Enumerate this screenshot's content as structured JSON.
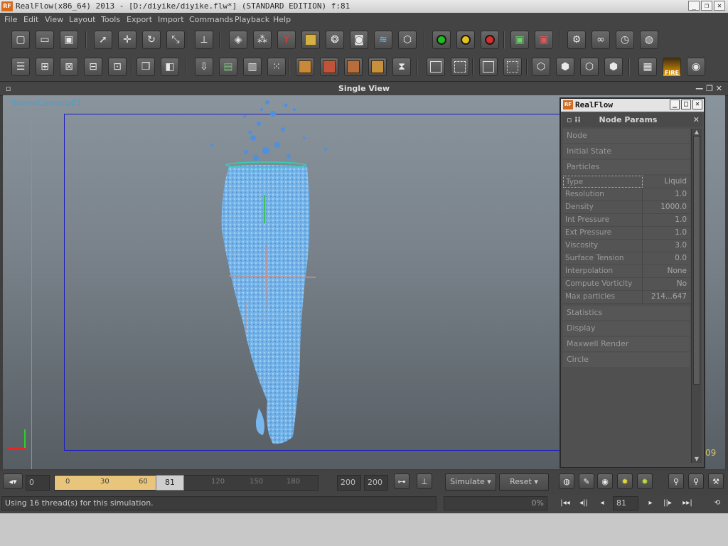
{
  "window": {
    "title": "RealFlow(x86_64) 2013 - [D:/diyike/diyike.flw*] (STANDARD EDITION) f:81",
    "logo_text": "RF",
    "minimize": "_",
    "maximize": "❐",
    "close": "✕"
  },
  "menu": [
    "File",
    "Edit",
    "View",
    "Layout",
    "Tools",
    "Export",
    "Import",
    "Commands",
    "Playback",
    "Help"
  ],
  "viewport": {
    "header": "Single View",
    "camera_label": "SceneCamera01",
    "frame_corner": "09"
  },
  "panel": {
    "title": "RealFlow",
    "logo_text": "RF",
    "header": "Node Params",
    "close": "✕",
    "sections_top": [
      "Node",
      "Initial State",
      "Particles"
    ],
    "params": [
      {
        "k": "Type",
        "v": "Liquid"
      },
      {
        "k": "Resolution",
        "v": "1.0"
      },
      {
        "k": "Density",
        "v": "1000.0"
      },
      {
        "k": "Int Pressure",
        "v": "1.0"
      },
      {
        "k": "Ext Pressure",
        "v": "1.0"
      },
      {
        "k": "Viscosity",
        "v": "3.0"
      },
      {
        "k": "Surface Tension",
        "v": "0.0"
      },
      {
        "k": "Interpolation",
        "v": "None"
      },
      {
        "k": "Compute Vorticity",
        "v": "No"
      },
      {
        "k": "Max particles",
        "v": "214...647"
      }
    ],
    "sections_bottom": [
      "Statistics",
      "Display",
      "Maxwell Render",
      "Circle"
    ]
  },
  "timeline": {
    "start_field": "0",
    "ticks": [
      "0",
      "30",
      "60",
      "90",
      "120",
      "150",
      "180"
    ],
    "current_frame": "81",
    "end_field_1": "200",
    "end_field_2": "200",
    "simulate": "Simulate",
    "reset": "Reset"
  },
  "status": {
    "message": "Using 16 thread(s) for this simulation.",
    "progress": "0%",
    "frame": "81"
  }
}
